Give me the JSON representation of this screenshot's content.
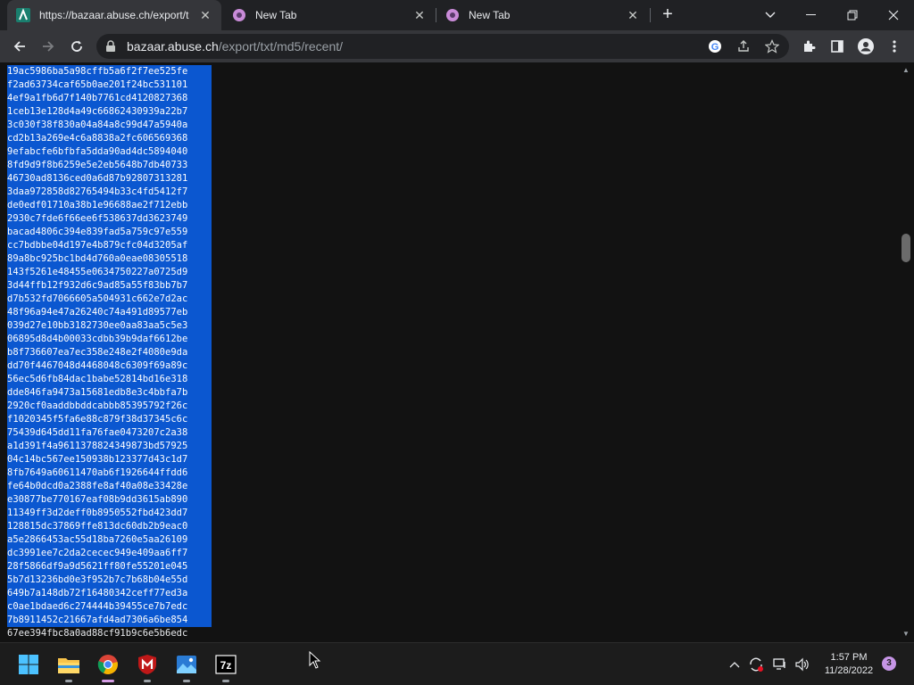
{
  "browser": {
    "tabs": [
      {
        "title": "https://bazaar.abuse.ch/export/t",
        "active": true,
        "favicon": "abuse-ch-icon"
      },
      {
        "title": "New Tab",
        "active": false,
        "favicon": "new-tab-icon"
      },
      {
        "title": "New Tab",
        "active": false,
        "favicon": "new-tab-icon"
      }
    ],
    "url_host": "bazaar.abuse.ch",
    "url_path": "/export/txt/md5/recent/"
  },
  "content": {
    "selected_lines": [
      "19ac5986ba5a98cffb5a6f2f7ee525fe",
      "f2ad63734caf65b0ae201f24bc531101",
      "4ef9a1fb6d7f140b7761cd4120827368",
      "1ceb13e128d4a49c66862430939a22b7",
      "3c030f38f830a04a84a8c99d47a5940a",
      "cd2b13a269e4c6a8838a2fc606569368",
      "9efabcfe6bfbfa5dda90ad4dc5894040",
      "8fd9d9f8b6259e5e2eb5648b7db40733",
      "46730ad8136ced0a6d87b92807313281",
      "3daa972858d82765494b33c4fd5412f7",
      "de0edf01710a38b1e96688ae2f712ebb",
      "2930c7fde6f66ee6f538637dd3623749",
      "bacad4806c394e839fad5a759c97e559",
      "cc7bdbbe04d197e4b879cfc04d3205af",
      "89a8bc925bc1bd4d760a0eae08305518",
      "143f5261e48455e0634750227a0725d9",
      "3d44ffb12f932d6c9ad85a55f83bb7b7",
      "d7b532fd7066605a504931c662e7d2ac",
      "48f96a94e47a26240c74a491d89577eb",
      "039d27e10bb3182730ee0aa83aa5c5e3",
      "06895d8d4b00033cdbb39b9daf6612be",
      "b8f736607ea7ec358e248e2f4080e9da",
      "dd70f4467048d4468048c6309f69a89c",
      "56ec5d6fb84dac1babe52814bd16e318",
      "dde846fa9473a15681edb8e3c4bbfa7b",
      "2920cf0aaddbbddcabbb85395792f26c",
      "f1020345f5fa6e88c879f38d37345c6c",
      "75439d645dd11fa76fae0473207c2a38",
      "a1d391f4a9611378824349873bd57925",
      "04c14bc567ee150938b123377d43c1d7",
      "8fb7649a60611470ab6f1926644ffdd6",
      "fe64b0dcd0a2388fe8af40a08e33428e",
      "e30877be770167eaf08b9dd3615ab890",
      "11349ff3d2deff0b8950552fbd423dd7",
      "128815dc37869ffe813dc60db2b9eac0",
      "a5e2866453ac55d18ba7260e5aa26109",
      "dc3991ee7c2da2cecec949e409aa6ff7",
      "28f5866df9a9d5621ff80fe55201e045",
      "5b7d13236bd0e3f952b7c7b68b04e55d",
      "649b7a148db72f16480342ceff77ed3a",
      "c0ae1bdaed6c274444b39455ce7b7edc",
      "7b8911452c21667afd4ad7306a6be854"
    ],
    "unselected_line": "67ee394fbc8a0ad88cf91b9c6e5b6edc"
  },
  "taskbar": {
    "apps": [
      {
        "name": "start-icon"
      },
      {
        "name": "file-explorer-icon"
      },
      {
        "name": "chrome-icon"
      },
      {
        "name": "mcafee-icon"
      },
      {
        "name": "photos-icon"
      },
      {
        "name": "7zip-icon"
      }
    ],
    "time": "1:57 PM",
    "date": "11/28/2022",
    "notification_count": "3"
  }
}
